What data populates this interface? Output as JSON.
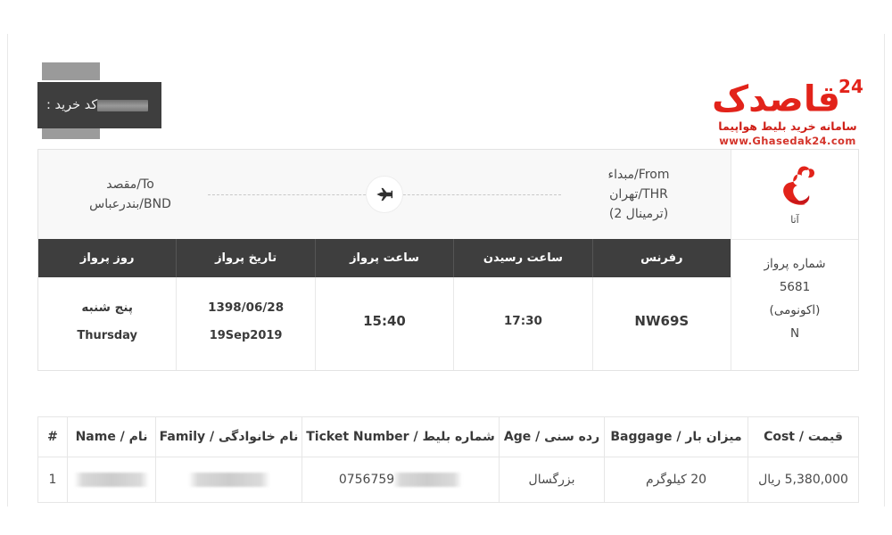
{
  "header": {
    "purchase_code_label": "کد خرید :",
    "purchase_code_value": "",
    "brand": {
      "wordmark": "قاصدک",
      "wordmark_number": "24",
      "tagline": "سامانه خرید بلیط هواپیما",
      "url": "www.Ghasedak24.com",
      "color": "#e2231a"
    }
  },
  "flight": {
    "airline": {
      "name": "آتا",
      "logo_icon": "ata-bird-logo",
      "logo_color": "#e2231a"
    },
    "route": {
      "destination": {
        "label": "To/مقصد",
        "value": "BND/بندرعباس"
      },
      "origin": {
        "label": "From/مبداء",
        "value": "THR/تهران",
        "terminal": "(ترمینال 2)"
      },
      "plane_icon": "airplane-icon"
    },
    "side_panel": {
      "flight_number_label": "شماره پرواز",
      "flight_number": "5681",
      "class_label": "(اکونومی)",
      "class_code": "N"
    },
    "columns": [
      {
        "key": "reference",
        "header": "رفرنس"
      },
      {
        "key": "arrival_time",
        "header": "ساعت رسیدن"
      },
      {
        "key": "departure_time",
        "header": "ساعت پرواز"
      },
      {
        "key": "flight_date",
        "header": "تاریخ پرواز"
      },
      {
        "key": "flight_day",
        "header": "روز پرواز"
      }
    ],
    "values": {
      "reference": "NW69S",
      "arrival_time": "17:30",
      "departure_time": "15:40",
      "flight_date": "1398/06/28",
      "flight_date_gregorian": "19Sep2019",
      "flight_day": "پنج شنبه",
      "flight_day_en": "Thursday"
    }
  },
  "passengers": {
    "columns": [
      {
        "key": "cost",
        "header": "قیمت / Cost"
      },
      {
        "key": "baggage",
        "header": "میزان بار / Baggage"
      },
      {
        "key": "age",
        "header": "رده سنی / Age"
      },
      {
        "key": "ticket_number",
        "header": "شماره بلیط / Ticket Number"
      },
      {
        "key": "family",
        "header": "نام خانوادگی / Family"
      },
      {
        "key": "name",
        "header": "نام / Name"
      },
      {
        "key": "index",
        "header": "#"
      }
    ],
    "rows": [
      {
        "cost": "5,380,000 ریال",
        "baggage": "20 کیلوگرم",
        "age": "بزرگسال",
        "ticket_number": "0756759",
        "family": "",
        "name": "",
        "index": "1"
      }
    ]
  }
}
